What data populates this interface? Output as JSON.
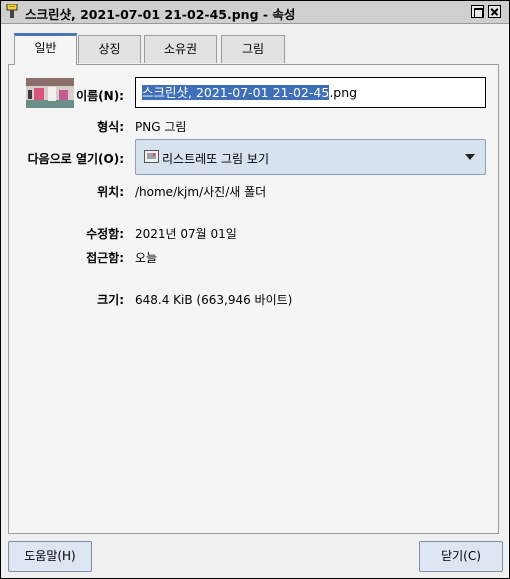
{
  "window": {
    "title": "스크린샷, 2021-07-01 21-02-45.png - 속성"
  },
  "tabs": [
    {
      "label": "일반",
      "active": true
    },
    {
      "label": "상징",
      "active": false
    },
    {
      "label": "소유권",
      "active": false
    },
    {
      "label": "그림",
      "active": false
    }
  ],
  "general": {
    "name_label": "이름(N):",
    "name_value_selected": "스크린샷, 2021-07-01 21-02-45",
    "name_value_rest": ".png",
    "type_label": "형식:",
    "type_value": "PNG 그림",
    "open_with_label": "다음으로 열기(O):",
    "open_with_value": "리스트레또 그림 보기",
    "location_label": "위치:",
    "location_value": "/home/kjm/사진/새 폴더",
    "modified_label": "수정함:",
    "modified_value": "2021년 07월 01일",
    "accessed_label": "접근함:",
    "accessed_value": "오늘",
    "size_label": "크기:",
    "size_value": "648.4 KiB (663,946 바이트)"
  },
  "footer": {
    "help_label": "도움말(H)",
    "close_label": "닫기(C)"
  },
  "colors": {
    "selection": "#3f6fb8",
    "active_tab_accent": "#4a78b5",
    "button_bg": "#dde6f2"
  },
  "icons": {
    "app": "brush-icon",
    "window_maximize": "maximize-icon",
    "window_close": "close-icon",
    "open_with_app": "image-viewer-icon",
    "dropdown": "chevron-down-icon"
  }
}
